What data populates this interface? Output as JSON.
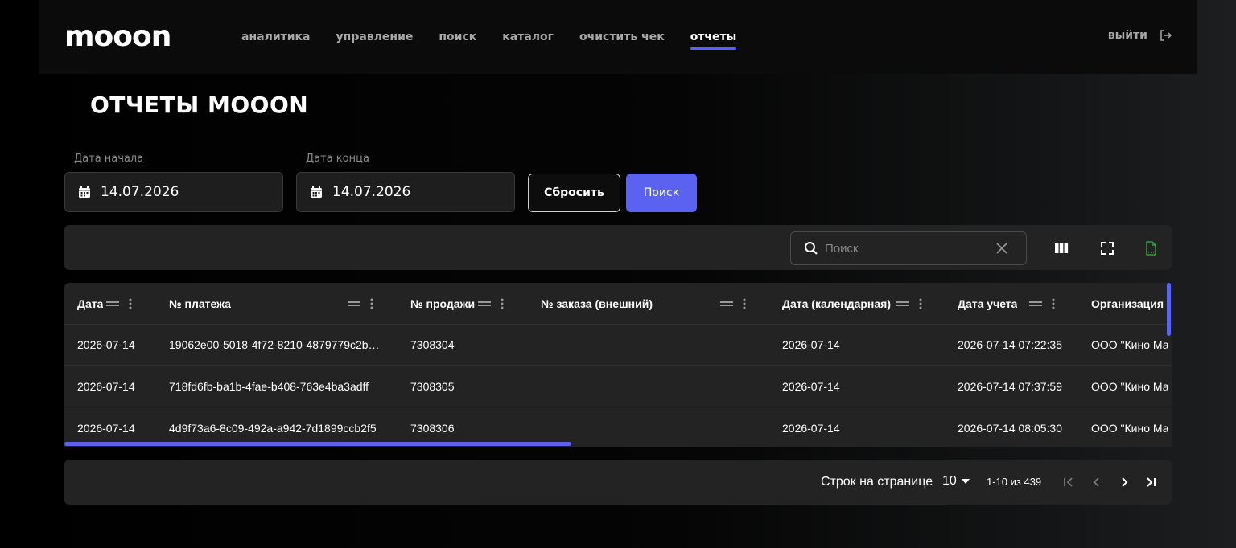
{
  "app": {
    "logo": "mooon"
  },
  "nav": {
    "items": [
      {
        "label": "аналитика"
      },
      {
        "label": "управление"
      },
      {
        "label": "поиск"
      },
      {
        "label": "каталог"
      },
      {
        "label": "очистить чек"
      },
      {
        "label": "отчеты",
        "active": true
      }
    ],
    "logout_label": "выйти"
  },
  "page": {
    "title": "ОТЧЕТЫ MOOON"
  },
  "filters": {
    "start_label": "Дата начала",
    "start_value": "14.07.2026",
    "end_label": "Дата конца",
    "end_value": "14.07.2026",
    "reset_label": "Сбросить",
    "search_label": "Поиск"
  },
  "toolbar": {
    "search_placeholder": "Поиск"
  },
  "table": {
    "columns": [
      "Дата",
      "№ платежа",
      "№ продажи",
      "№ заказа (внешний)",
      "Дата (календарная)",
      "Дата учета",
      "Организация"
    ],
    "rows": [
      [
        "2026-07-14",
        "19062e00-5018-4f72-8210-4879779c2b…",
        "7308304",
        "",
        "2026-07-14",
        "2026-07-14 07:22:35",
        "ООО \"Кино Ма"
      ],
      [
        "2026-07-14",
        "718fd6fb-ba1b-4fae-b408-763e4ba3adff",
        "7308305",
        "",
        "2026-07-14",
        "2026-07-14 07:37:59",
        "ООО \"Кино Ма"
      ],
      [
        "2026-07-14",
        "4d9f73a6-8c09-492a-a942-7d1899ccb2f5",
        "7308306",
        "",
        "2026-07-14",
        "2026-07-14 08:05:30",
        "ООО \"Кино Ма"
      ]
    ]
  },
  "pagination": {
    "rows_per_page_label": "Строк на странице",
    "rows_per_page": "10",
    "range": "1-10 из 439"
  },
  "colors": {
    "accent": "#5b62f0",
    "export_icon": "#3db04a"
  }
}
